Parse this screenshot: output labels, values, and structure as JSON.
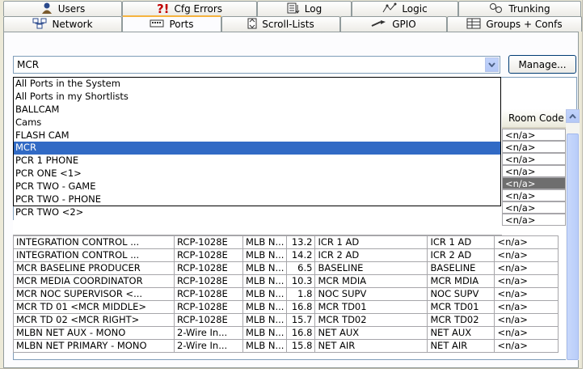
{
  "tabs_row1": [
    {
      "label": "Users",
      "icon": "users-icon"
    },
    {
      "label": "Cfg Errors",
      "icon": "config-errors-icon"
    },
    {
      "label": "Log",
      "icon": "log-icon"
    },
    {
      "label": "Logic",
      "icon": "logic-icon"
    },
    {
      "label": "Trunking",
      "icon": "trunking-icon"
    }
  ],
  "tabs_row2": [
    {
      "label": "Network",
      "icon": "network-icon"
    },
    {
      "label": "Ports",
      "icon": "ports-icon",
      "active": true
    },
    {
      "label": "Scroll-Lists",
      "icon": "scroll-lists-icon"
    },
    {
      "label": "GPIO",
      "icon": "gpio-icon"
    },
    {
      "label": "Groups + Confs",
      "icon": "groups-confs-icon"
    }
  ],
  "combo": {
    "value": "MCR"
  },
  "manage_label": "Manage...",
  "dropdown_items": [
    "All Ports in the System",
    "All Ports in my Shortlists",
    "BALLCAM",
    "Cams",
    "FLASH CAM",
    "MCR",
    "PCR 1 PHONE",
    "PCR ONE <1>",
    "PCR TWO - GAME",
    "PCR TWO - PHONE",
    "PCR TWO <2>"
  ],
  "selected_item": "MCR",
  "grid": {
    "visible_header": "Room Code",
    "room_codes_above": [
      "<n/a>",
      "<n/a>",
      "<n/a>",
      "<n/a>",
      "<n/a>",
      "<n/a>",
      "<n/a>",
      "<n/a>"
    ],
    "rows": [
      [
        "INTEGRATION CONTROL ...",
        "RCP-1028E",
        "MLB N...",
        "13.2",
        "ICR 1 AD",
        "ICR 1 AD",
        "<n/a>"
      ],
      [
        "INTEGRATION CONTROL ...",
        "RCP-1028E",
        "MLB N...",
        "14.2",
        "ICR 2 AD",
        "ICR 2 AD",
        "<n/a>"
      ],
      [
        "MCR BASELINE PRODUCER",
        "RCP-1028E",
        "MLB N...",
        "6.5",
        "BASELINE",
        "BASELINE",
        "<n/a>"
      ],
      [
        "MCR MEDIA COORDINATOR",
        "RCP-1028E",
        "MLB N...",
        "10.3",
        "MCR MDIA",
        "MCR MDIA",
        "<n/a>"
      ],
      [
        "MCR NOC SUPERVISOR <...",
        "RCP-1028E",
        "MLB N...",
        "1.8",
        "NOC SUPV",
        "NOC SUPV",
        "<n/a>"
      ],
      [
        "MCR TD 01 <MCR MIDDLE>",
        "RCP-1028E",
        "MLB N...",
        "16.8",
        "MCR TD01",
        "MCR TD01",
        "<n/a>"
      ],
      [
        "MCR TD 02 <MCR RIGHT>",
        "RCP-1028E",
        "MLB N...",
        "15.7",
        "MCR TD02",
        "MCR TD02",
        "<n/a>"
      ],
      [
        "MLBN NET AUX - MONO",
        "2-Wire In...",
        "MLB N...",
        "16.8",
        "NET AUX",
        "NET AUX",
        "<n/a>"
      ],
      [
        "MLBN NET PRIMARY - MONO",
        "2-Wire In...",
        "MLB N...",
        "15.8",
        "NET AIR",
        "NET AIR",
        "<n/a>"
      ]
    ]
  },
  "colors": {
    "selection": "#316ac5",
    "active_tab_accent": "#f5b33f",
    "panel_bg": "#ece9d8"
  }
}
